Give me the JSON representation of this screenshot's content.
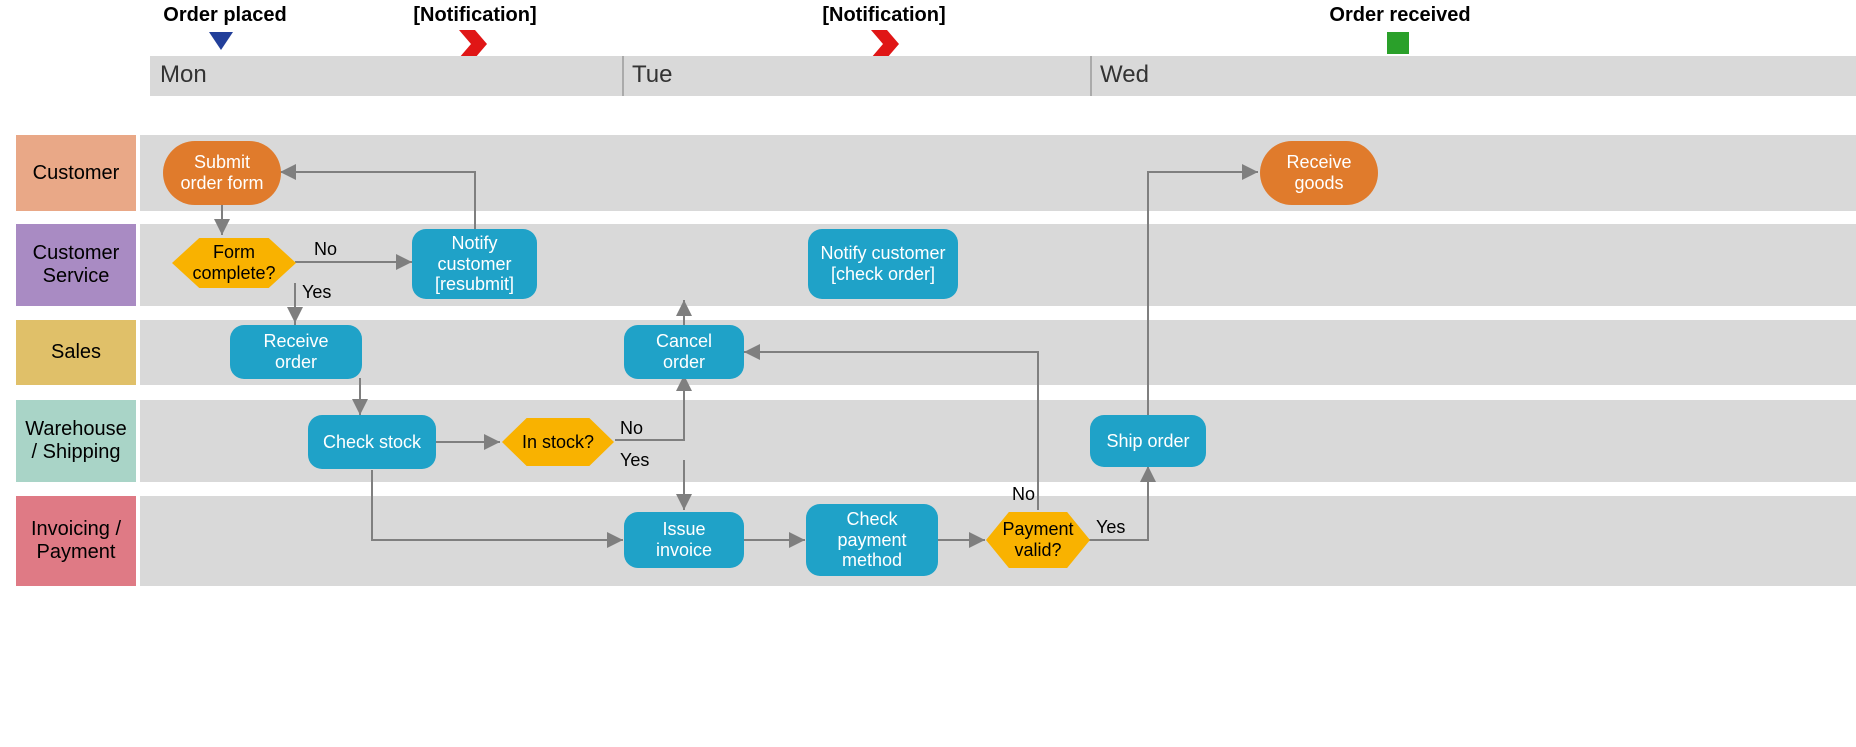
{
  "timeline": {
    "days": [
      "Mon",
      "Tue",
      "Wed"
    ]
  },
  "milestones": {
    "order_placed": "Order placed",
    "notification1": "[Notification]",
    "notification2": "[Notification]",
    "order_received": "Order received"
  },
  "lanes": {
    "customer": "Customer",
    "customer_service": "Customer Service",
    "sales": "Sales",
    "warehouse": "Warehouse / Shipping",
    "invoicing": "Invoicing / Payment"
  },
  "nodes": {
    "submit_order": "Submit order form",
    "form_complete": "Form complete?",
    "notify_resubmit": "Notify customer [resubmit]",
    "receive_order": "Receive order",
    "check_stock": "Check stock",
    "in_stock": "In stock?",
    "cancel_order": "Cancel order",
    "notify_check_order": "Notify customer [check order]",
    "issue_invoice": "Issue invoice",
    "check_payment": "Check payment method",
    "payment_valid": "Payment valid?",
    "ship_order": "Ship order",
    "receive_goods": "Receive goods"
  },
  "conditions": {
    "no": "No",
    "yes": "Yes"
  },
  "chart_data": {
    "type": "swimlane-flowchart",
    "timeline_columns": [
      "Mon",
      "Tue",
      "Wed"
    ],
    "milestones": [
      {
        "label": "Order placed",
        "column": "Mon",
        "icon": "triangle"
      },
      {
        "label": "[Notification]",
        "column": "Mon",
        "icon": "red-chevron"
      },
      {
        "label": "[Notification]",
        "column": "Tue",
        "icon": "red-chevron"
      },
      {
        "label": "Order received",
        "column": "Wed",
        "icon": "green-square"
      }
    ],
    "swimlanes": [
      {
        "id": "customer",
        "label": "Customer",
        "color": "#e9a887"
      },
      {
        "id": "customer_service",
        "label": "Customer Service",
        "color": "#a98bc3"
      },
      {
        "id": "sales",
        "label": "Sales",
        "color": "#e0c069"
      },
      {
        "id": "warehouse",
        "label": "Warehouse / Shipping",
        "color": "#a9d4c7"
      },
      {
        "id": "invoicing",
        "label": "Invoicing / Payment",
        "color": "#df7a85"
      }
    ],
    "nodes": [
      {
        "id": "submit_order",
        "lane": "customer",
        "column": "Mon",
        "type": "terminator",
        "label": "Submit order form"
      },
      {
        "id": "form_complete",
        "lane": "customer_service",
        "column": "Mon",
        "type": "decision",
        "label": "Form complete?"
      },
      {
        "id": "notify_resubmit",
        "lane": "customer_service",
        "column": "Mon",
        "type": "process",
        "label": "Notify customer [resubmit]"
      },
      {
        "id": "receive_order",
        "lane": "sales",
        "column": "Mon",
        "type": "process",
        "label": "Receive order"
      },
      {
        "id": "check_stock",
        "lane": "warehouse",
        "column": "Mon",
        "type": "process",
        "label": "Check stock"
      },
      {
        "id": "in_stock",
        "lane": "warehouse",
        "column": "Mon/Tue",
        "type": "decision",
        "label": "In stock?"
      },
      {
        "id": "cancel_order",
        "lane": "sales",
        "column": "Tue",
        "type": "process",
        "label": "Cancel order"
      },
      {
        "id": "notify_check_order",
        "lane": "customer_service",
        "column": "Tue",
        "type": "process",
        "label": "Notify customer [check order]"
      },
      {
        "id": "issue_invoice",
        "lane": "invoicing",
        "column": "Tue",
        "type": "process",
        "label": "Issue invoice"
      },
      {
        "id": "check_payment",
        "lane": "invoicing",
        "column": "Tue",
        "type": "process",
        "label": "Check payment method"
      },
      {
        "id": "payment_valid",
        "lane": "invoicing",
        "column": "Tue/Wed",
        "type": "decision",
        "label": "Payment valid?"
      },
      {
        "id": "ship_order",
        "lane": "warehouse",
        "column": "Wed",
        "type": "process",
        "label": "Ship order"
      },
      {
        "id": "receive_goods",
        "lane": "customer",
        "column": "Wed",
        "type": "terminator",
        "label": "Receive goods"
      }
    ],
    "edges": [
      {
        "from": "submit_order",
        "to": "form_complete"
      },
      {
        "from": "form_complete",
        "to": "notify_resubmit",
        "label": "No"
      },
      {
        "from": "form_complete",
        "to": "receive_order",
        "label": "Yes"
      },
      {
        "from": "notify_resubmit",
        "to": "submit_order"
      },
      {
        "from": "receive_order",
        "to": "check_stock"
      },
      {
        "from": "check_stock",
        "to": "in_stock"
      },
      {
        "from": "in_stock",
        "to": "cancel_order",
        "label": "No"
      },
      {
        "from": "in_stock",
        "to": "issue_invoice",
        "label": "Yes"
      },
      {
        "from": "cancel_order",
        "to": "notify_check_order"
      },
      {
        "from": "check_stock",
        "to": "issue_invoice"
      },
      {
        "from": "issue_invoice",
        "to": "check_payment"
      },
      {
        "from": "check_payment",
        "to": "payment_valid"
      },
      {
        "from": "payment_valid",
        "to": "cancel_order",
        "label": "No"
      },
      {
        "from": "payment_valid",
        "to": "ship_order",
        "label": "Yes"
      },
      {
        "from": "ship_order",
        "to": "receive_goods"
      }
    ]
  }
}
